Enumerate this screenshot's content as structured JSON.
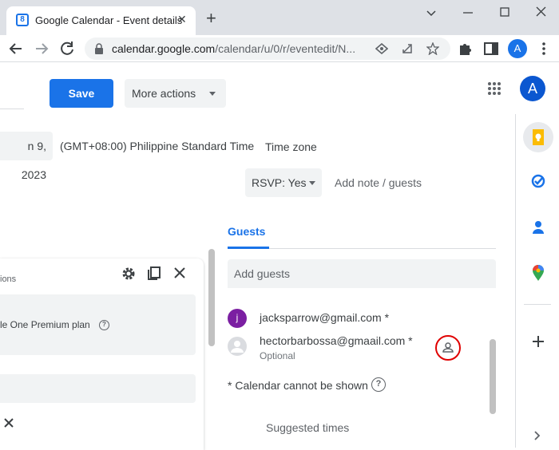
{
  "browser": {
    "tab_title": "Google Calendar - Event details",
    "favicon_text": "8",
    "url_host": "calendar.google.com",
    "url_path": "/calendar/u/0/r/eventedit/N...",
    "profile_initial": "A"
  },
  "header": {
    "save_label": "Save",
    "more_actions_label": "More actions",
    "account_initial": "A"
  },
  "event": {
    "date_fragment": "n 9, 2023",
    "timezone_value": "(GMT+08:00) Philippine Standard Time",
    "timezone_label": "Time zone",
    "rsvp_label": "RSVP: Yes",
    "add_note_label": "Add note / guests"
  },
  "guests": {
    "tab_label": "Guests",
    "add_placeholder": "Add guests",
    "list": [
      {
        "initial": "j",
        "email": "jacksparrow@gmail.com *",
        "sub": "",
        "avatar_color": "#7b1fa2"
      },
      {
        "initial": "",
        "email": "hectorbarbossa@gmaail.com *",
        "sub": "Optional",
        "avatar_color": "#dadce0"
      }
    ],
    "calendar_note": "* Calendar cannot be shown",
    "suggested_times": "Suggested times"
  },
  "left_panel": {
    "title_fragment": "ions",
    "plan_text": "le One Premium plan"
  },
  "colors": {
    "accent": "#1a73e8",
    "highlight_ring": "#e00000"
  },
  "icons": {
    "side_panel": [
      "keep-icon",
      "tasks-icon",
      "contacts-icon",
      "maps-icon",
      "add-icon",
      "chevron-right-icon"
    ]
  }
}
